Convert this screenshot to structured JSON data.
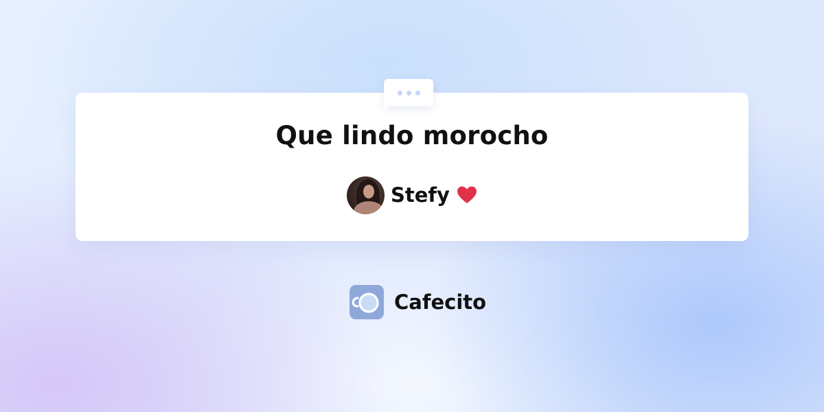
{
  "message": {
    "text": "Que lindo morocho"
  },
  "supporter": {
    "name": "Stefy",
    "emoji_icon": "heart-icon",
    "emoji_color": "#e0334a"
  },
  "brand": {
    "name": "Cafecito",
    "logo_icon": "cafecito-cup-logo",
    "logo_color": "#8fa8da"
  },
  "bubble": {
    "icon": "chat-bubble-dots-icon",
    "dot_color": "#c3d6f5"
  }
}
